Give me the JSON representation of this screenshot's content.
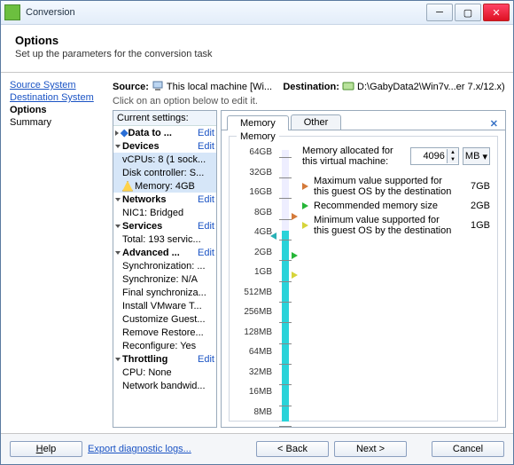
{
  "window": {
    "title": "Conversion"
  },
  "header": {
    "title": "Options",
    "subtitle": "Set up the parameters for the conversion task"
  },
  "nav": {
    "items": [
      {
        "label": "Source System",
        "kind": "link"
      },
      {
        "label": "Destination System",
        "kind": "link"
      },
      {
        "label": "Options",
        "kind": "active"
      },
      {
        "label": "Summary",
        "kind": "plain"
      }
    ]
  },
  "source": {
    "label": "Source:",
    "value": "This local machine [Wi..."
  },
  "destination": {
    "label": "Destination:",
    "value": "D:\\GabyData2\\Win7v...er 7.x/12.x)"
  },
  "hint": "Click on an option below to edit it.",
  "settings": {
    "header": "Current settings:",
    "items": [
      {
        "label": "Data to ...",
        "group": true,
        "arrow": "right",
        "edit": "Edit",
        "diamond": true
      },
      {
        "label": "Devices",
        "group": true,
        "arrow": "down",
        "edit": "Edit"
      },
      {
        "label": "vCPUs: 8 (1 sock...",
        "indent": true,
        "sel": true
      },
      {
        "label": "Disk controller: S...",
        "indent": true,
        "sel": true
      },
      {
        "label": "Memory: 4GB",
        "indent": true,
        "sel": true,
        "warn": true
      },
      {
        "label": "Networks",
        "group": true,
        "arrow": "down",
        "edit": "Edit"
      },
      {
        "label": "NIC1: Bridged",
        "indent": true
      },
      {
        "label": "Services",
        "group": true,
        "arrow": "down",
        "edit": "Edit"
      },
      {
        "label": "Total: 193 servic...",
        "indent": true
      },
      {
        "label": "Advanced ...",
        "group": true,
        "arrow": "down",
        "edit": "Edit"
      },
      {
        "label": "Synchronization: ...",
        "indent": true
      },
      {
        "label": "Synchronize: N/A",
        "indent": true
      },
      {
        "label": "Final synchroniza...",
        "indent": true
      },
      {
        "label": "Install VMware T...",
        "indent": true
      },
      {
        "label": "Customize Guest...",
        "indent": true
      },
      {
        "label": "Remove Restore...",
        "indent": true
      },
      {
        "label": "Reconfigure: Yes",
        "indent": true
      },
      {
        "label": "Throttling",
        "group": true,
        "arrow": "down",
        "edit": "Edit"
      },
      {
        "label": "CPU: None",
        "indent": true
      },
      {
        "label": "Network bandwid...",
        "indent": true
      }
    ]
  },
  "tabs": {
    "memory": "Memory",
    "other": "Other",
    "active": "memory"
  },
  "memory": {
    "legend": "Memory",
    "scale": [
      "64GB",
      "32GB",
      "16GB",
      "8GB",
      "4GB",
      "2GB",
      "1GB",
      "512MB",
      "256MB",
      "128MB",
      "64MB",
      "32MB",
      "16MB",
      "8MB"
    ],
    "alloc_label": "Memory allocated for this virtual machine:",
    "alloc_value": "4096",
    "alloc_unit": "MB",
    "markers": [
      {
        "color": "#d47a3a",
        "text": "Maximum value supported for this guest OS by the destination",
        "value": "7GB"
      },
      {
        "color": "#26b638",
        "text": "Recommended memory size",
        "value": "2GB"
      },
      {
        "color": "#d6d43a",
        "text": "Minimum value supported for this guest OS by the destination",
        "value": "1GB"
      }
    ]
  },
  "footer": {
    "help": "Help",
    "export": "Export diagnostic logs...",
    "back": "< Back",
    "next": "Next >",
    "cancel": "Cancel"
  }
}
